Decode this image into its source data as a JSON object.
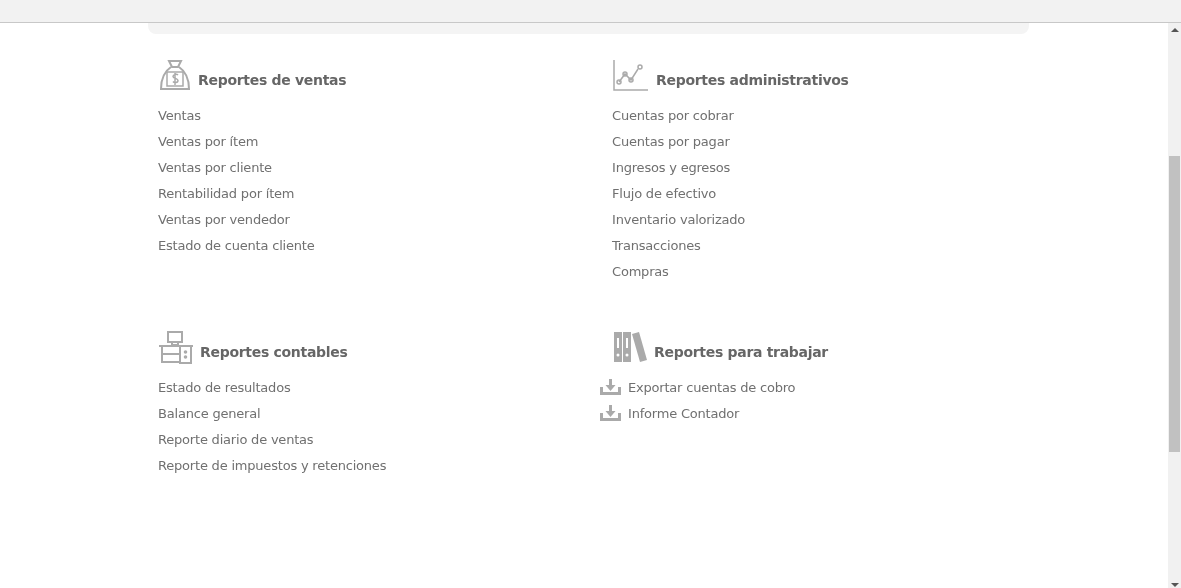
{
  "sections": [
    {
      "title": "Reportes de ventas",
      "kind": "sales",
      "items": [
        {
          "label": "Ventas",
          "kind": "link"
        },
        {
          "label": "Ventas por ítem",
          "kind": "link"
        },
        {
          "label": "Ventas por cliente",
          "kind": "link"
        },
        {
          "label": "Rentabilidad por ítem",
          "kind": "link"
        },
        {
          "label": "Ventas por vendedor",
          "kind": "link"
        },
        {
          "label": "Estado de cuenta cliente",
          "kind": "link"
        }
      ]
    },
    {
      "title": "Reportes administrativos",
      "kind": "administrative",
      "items": [
        {
          "label": "Cuentas por cobrar",
          "kind": "link"
        },
        {
          "label": "Cuentas por pagar",
          "kind": "link"
        },
        {
          "label": "Ingresos y egresos",
          "kind": "link"
        },
        {
          "label": "Flujo de efectivo",
          "kind": "link"
        },
        {
          "label": "Inventario valorizado",
          "kind": "link"
        },
        {
          "label": "Transacciones",
          "kind": "link"
        },
        {
          "label": "Compras",
          "kind": "link"
        }
      ]
    },
    {
      "title": "Reportes contables",
      "kind": "accounting",
      "items": [
        {
          "label": "Estado de resultados",
          "kind": "link"
        },
        {
          "label": "Balance general",
          "kind": "link"
        },
        {
          "label": "Reporte diario de ventas",
          "kind": "link"
        },
        {
          "label": "Reporte de impuestos y retenciones",
          "kind": "link"
        }
      ]
    },
    {
      "title": "Reportes para trabajar",
      "kind": "work",
      "items": [
        {
          "label": "Exportar cuentas de cobro",
          "kind": "download"
        },
        {
          "label": "Informe Contador",
          "kind": "download"
        }
      ]
    }
  ]
}
